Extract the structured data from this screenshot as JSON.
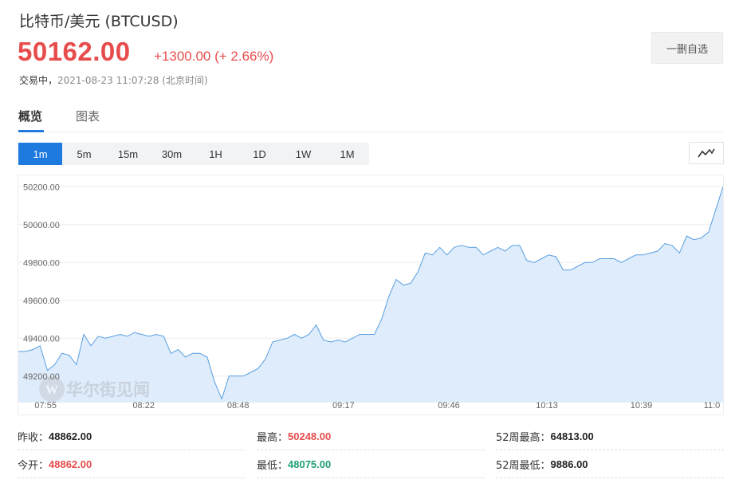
{
  "header": {
    "title": "比特币/美元  (BTCUSD)",
    "price": "50162.00",
    "change": "+1300.00 (+ 2.66%)",
    "status_label": "交易中，",
    "timestamp": "2021-08-23 11:07:28",
    "timezone": "(北京时间)",
    "fav_button": "一删自选"
  },
  "tabs": [
    {
      "label": "概览",
      "active": true
    },
    {
      "label": "图表",
      "active": false
    }
  ],
  "periods": [
    {
      "label": "1m",
      "active": true
    },
    {
      "label": "5m"
    },
    {
      "label": "15m"
    },
    {
      "label": "30m"
    },
    {
      "label": "1H"
    },
    {
      "label": "1D"
    },
    {
      "label": "1W"
    },
    {
      "label": "1M"
    }
  ],
  "icons": {
    "chart_type": "line-chart-icon",
    "watermark_logo": "wallstreetcn-logo"
  },
  "watermark": "华尔街见闻",
  "colors": {
    "up": "#e74c4c",
    "down": "#1fa074",
    "accent": "#1f7ae0",
    "line": "#5a9fe0",
    "fill": "#deecfb"
  },
  "chart_data": {
    "type": "area",
    "ylim": [
      49060,
      50260
    ],
    "yticks": [
      "50200.00",
      "50000.00",
      "49800.00",
      "49600.00",
      "49400.00",
      "49200.00"
    ],
    "ytick_values": [
      50200,
      50000,
      49800,
      49600,
      49400,
      49200
    ],
    "xticks": [
      "07:55",
      "08:22",
      "08:48",
      "09:17",
      "09:46",
      "10:13",
      "10:39",
      "11:0"
    ],
    "xtick_values": [
      7.5,
      34.5,
      60.5,
      89.5,
      118.5,
      145.5,
      171.5,
      193
    ],
    "grid": true,
    "x": [
      0,
      2,
      4,
      6,
      8,
      10,
      12,
      14,
      16,
      18,
      20,
      22,
      24,
      26,
      28,
      30,
      32,
      34,
      36,
      38,
      40,
      42,
      44,
      46,
      48,
      50,
      52,
      54,
      56,
      58,
      60,
      62,
      64,
      66,
      68,
      70,
      72,
      74,
      76,
      78,
      80,
      82,
      84,
      86,
      88,
      90,
      92,
      94,
      96,
      98,
      100,
      102,
      104,
      106,
      108,
      110,
      112,
      114,
      116,
      118,
      120,
      122,
      124,
      126,
      128,
      130,
      132,
      134,
      136,
      138,
      140,
      142,
      144,
      146,
      148,
      150,
      152,
      154,
      156,
      158,
      160,
      162,
      164,
      166,
      168,
      170,
      172,
      174,
      176,
      178,
      180,
      182,
      184,
      186,
      188,
      190,
      192,
      194
    ],
    "y": [
      49330,
      49330,
      49340,
      49360,
      49230,
      49260,
      49320,
      49310,
      49260,
      49420,
      49360,
      49410,
      49400,
      49410,
      49420,
      49410,
      49430,
      49420,
      49410,
      49420,
      49410,
      49320,
      49340,
      49300,
      49320,
      49320,
      49300,
      49170,
      49080,
      49200,
      49200,
      49200,
      49220,
      49240,
      49290,
      49380,
      49390,
      49400,
      49420,
      49400,
      49420,
      49470,
      49390,
      49380,
      49390,
      49380,
      49400,
      49420,
      49420,
      49420,
      49500,
      49620,
      49710,
      49680,
      49690,
      49750,
      49850,
      49840,
      49880,
      49840,
      49880,
      49890,
      49880,
      49880,
      49840,
      49860,
      49880,
      49860,
      49890,
      49890,
      49810,
      49800,
      49820,
      49840,
      49830,
      49760,
      49760,
      49780,
      49800,
      49800,
      49820,
      49820,
      49820,
      49800,
      49820,
      49840,
      49840,
      49850,
      49860,
      49900,
      49890,
      49850,
      49940,
      49920,
      49930,
      49960,
      50080,
      50200,
      50140,
      50090,
      50100,
      50110,
      50140,
      50160,
      50140,
      50160,
      50162
    ]
  },
  "stats": [
    [
      {
        "label": "昨收：",
        "value": "48862.00",
        "tone": "neutral"
      },
      {
        "label": "最高：",
        "value": "50248.00",
        "tone": "up"
      },
      {
        "label": "52周最高：",
        "value": "64813.00",
        "tone": "neutral"
      }
    ],
    [
      {
        "label": "今开：",
        "value": "48862.00",
        "tone": "up"
      },
      {
        "label": "最低：",
        "value": "48075.00",
        "tone": "down"
      },
      {
        "label": "52周最低：",
        "value": "9886.00",
        "tone": "neutral"
      }
    ]
  ]
}
